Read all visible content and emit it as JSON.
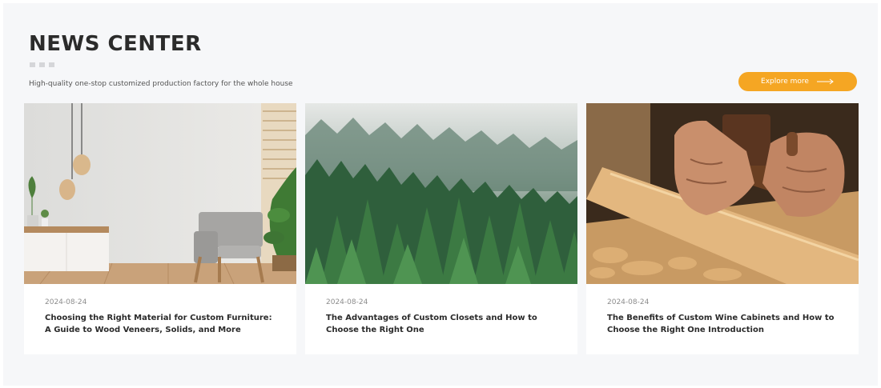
{
  "header": {
    "title": "NEWS CENTER",
    "subtitle": "High-quality one-stop customized production factory for the whole house",
    "explore_label": "Explore more"
  },
  "colors": {
    "accent": "#f5a623",
    "background": "#f6f7f9"
  },
  "news": [
    {
      "date": "2024-08-24",
      "title": "Choosing the Right Material for Custom Furniture: A Guide to Wood Veneers, Solids, and More",
      "image": "living-room-armchair-photo"
    },
    {
      "date": "2024-08-24",
      "title": "The Advantages of Custom Closets and How to Choose the Right One",
      "image": "misty-pine-forest-photo"
    },
    {
      "date": "2024-08-24",
      "title": "The Benefits of Custom Wine Cabinets and How to Choose the Right One Introduction",
      "image": "hand-planing-wood-photo"
    }
  ]
}
